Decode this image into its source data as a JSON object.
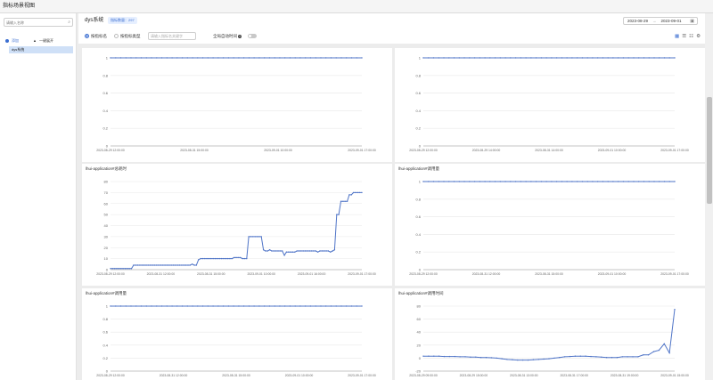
{
  "window": {
    "title": "指标场景视图"
  },
  "sidebar": {
    "search_placeholder": "请输入名称",
    "add_label": "添加",
    "expand_label": "一键展开",
    "items": [
      {
        "label": "dys系统"
      }
    ]
  },
  "header": {
    "system_name": "dys系统",
    "count_badge": "指标数量：297",
    "date_start": "2023-08-29",
    "date_end": "2023-09-01"
  },
  "toolbar": {
    "mode_metric": "按指标名",
    "mode_scene": "按指标类型",
    "filter_placeholder": "请输入指标名关键字",
    "global_time_label": "全局自动时间"
  },
  "colors": {
    "line": "#4f74c7",
    "accent": "#3b6ed1"
  },
  "chart_data": [
    {
      "type": "line",
      "title": "",
      "x_labels": [
        "2023-08-29 12:00:00",
        "2023-08-31 15:00:00",
        "2023-09-01 10:00:00",
        "2023-09-01 17:00:00"
      ],
      "y_ticks": [
        0,
        0.2,
        0.4,
        0.6,
        0.8,
        1
      ],
      "series": [
        {
          "values": [
            1,
            1,
            1,
            1,
            1,
            1,
            1,
            1,
            1,
            1,
            1,
            1,
            1,
            1,
            1,
            1,
            1,
            1,
            1,
            1,
            1,
            1,
            1,
            1,
            1,
            1,
            1,
            1,
            1,
            1,
            1,
            1,
            1,
            1,
            1,
            1,
            1,
            1,
            1,
            1,
            1,
            1,
            1,
            1,
            1,
            1,
            1,
            1,
            1,
            1
          ]
        }
      ]
    },
    {
      "type": "line",
      "title": "",
      "x_labels": [
        "2023-08-29 12:00:00",
        "2023-08-29 14:00:00",
        "2023-08-31 14:00:00",
        "2023-09-01 10:00:00",
        "2023-09-01 17:00:00"
      ],
      "y_ticks": [
        0,
        0.2,
        0.4,
        0.6,
        0.8,
        1
      ],
      "series": [
        {
          "values": [
            1,
            1,
            1,
            1,
            1,
            1,
            1,
            1,
            1,
            1,
            1,
            1,
            1,
            1,
            1,
            1,
            1,
            1,
            1,
            1,
            1,
            1,
            1,
            1,
            1,
            1,
            1,
            1,
            1,
            1,
            1,
            1,
            1,
            1,
            1,
            1,
            1,
            1,
            1,
            1,
            1,
            1,
            1,
            1,
            1,
            1,
            1,
            1,
            1,
            1
          ]
        }
      ]
    },
    {
      "type": "line",
      "title": "lhui-application#总耗时",
      "x_labels": [
        "2023-08-29 12:00:00",
        "2023-08-31 12:00:00",
        "2023-08-31 15:00:00",
        "2023-09-01 10:00:00",
        "2023-09-01 16:00:00",
        "2023-09-01 17:00:00"
      ],
      "y_ticks": [
        0,
        10,
        20,
        30,
        40,
        50,
        60,
        70,
        80
      ],
      "series": [
        {
          "values": [
            1,
            1,
            1,
            1,
            1,
            1,
            1,
            1,
            1,
            1,
            1,
            4,
            4,
            4,
            4,
            4,
            4,
            4,
            4,
            4,
            4,
            4,
            4,
            4,
            4,
            4,
            4,
            4,
            4,
            4,
            4,
            4,
            4,
            4,
            4,
            4,
            4,
            4,
            4,
            5,
            4,
            4,
            9,
            10,
            10,
            10,
            10,
            10,
            10,
            10,
            10,
            10,
            10,
            10,
            10,
            10,
            10,
            10,
            10,
            11,
            11,
            11,
            11,
            10,
            10,
            10,
            30,
            30,
            30,
            30,
            30,
            30,
            30,
            18,
            17,
            17,
            18,
            17,
            17,
            17,
            17,
            17,
            17,
            13,
            16,
            16,
            16,
            16,
            16,
            17,
            17,
            17,
            17,
            17,
            17,
            17,
            17,
            17,
            17,
            16,
            17,
            17,
            17,
            17,
            17,
            16,
            17,
            18,
            50,
            50,
            62,
            62,
            62,
            62,
            68,
            68,
            70,
            70,
            70,
            70,
            70
          ]
        }
      ]
    },
    {
      "type": "line",
      "title": "lhui-application#调用量",
      "x_labels": [
        "2023-08-29 12:00:00",
        "2023-08-31 12:00:00",
        "2023-08-31 15:00:00",
        "2023-09-01 10:00:00",
        "2023-09-01 17:00:00"
      ],
      "y_ticks": [
        0,
        0.2,
        0.4,
        0.6,
        0.8,
        1
      ],
      "series": [
        {
          "values": [
            1,
            1,
            1,
            1,
            1,
            1,
            1,
            1,
            1,
            1,
            1,
            1,
            1,
            1,
            1,
            1,
            1,
            1,
            1,
            1,
            1,
            1,
            1,
            1,
            1,
            1,
            1,
            1,
            1,
            1,
            1,
            1,
            1,
            1,
            1,
            1,
            1,
            1,
            1,
            1,
            1,
            1,
            1,
            1,
            1,
            1,
            1,
            1,
            1,
            1
          ]
        }
      ]
    },
    {
      "type": "line",
      "title": "lhui-application#调用量",
      "x_labels": [
        "2023-08-29 12:00:00",
        "2023-08-31 12:00:00",
        "2023-08-31 15:00:00",
        "2023-09-01 10:00:00",
        "2023-09-01 17:00:00"
      ],
      "y_ticks": [
        0,
        0.2,
        0.4,
        0.6,
        0.8,
        1
      ],
      "series": [
        {
          "values": [
            1,
            1,
            1,
            1,
            1,
            1,
            1,
            1,
            1,
            1,
            1,
            1,
            1,
            1,
            1,
            1,
            1,
            1,
            1,
            1,
            1,
            1,
            1,
            1,
            1,
            1,
            1,
            1,
            1,
            1,
            1,
            1,
            1,
            1,
            1,
            1,
            1,
            1,
            1,
            1,
            1,
            1,
            1,
            1,
            1,
            1,
            1,
            1,
            1,
            1
          ]
        }
      ]
    },
    {
      "type": "line",
      "title": "lhui-application#调用时间",
      "x_labels": [
        "2023-08-29 09:00:00",
        "2023-08-29 15:00:00",
        "2023-08-31 13:00:00",
        "2023-08-31 17:00:00",
        "2023-08-31 19:00:00",
        "2023-09-01 15:00:00"
      ],
      "y_ticks": [
        -20,
        0,
        20,
        40,
        60,
        80
      ],
      "series": [
        {
          "values": [
            3,
            3,
            3,
            3,
            2.5,
            2.5,
            2.5,
            2,
            2,
            1.5,
            1.5,
            1,
            1,
            0.5,
            0,
            -1,
            -2,
            -2.5,
            -3,
            -3,
            -3,
            -2.5,
            -2,
            -1.5,
            -1,
            0,
            1,
            2,
            2.5,
            3,
            3,
            3,
            2.5,
            2,
            1.5,
            1,
            1,
            1,
            2,
            2,
            2,
            2,
            5,
            5,
            10,
            12,
            22,
            8,
            75
          ]
        }
      ]
    }
  ]
}
